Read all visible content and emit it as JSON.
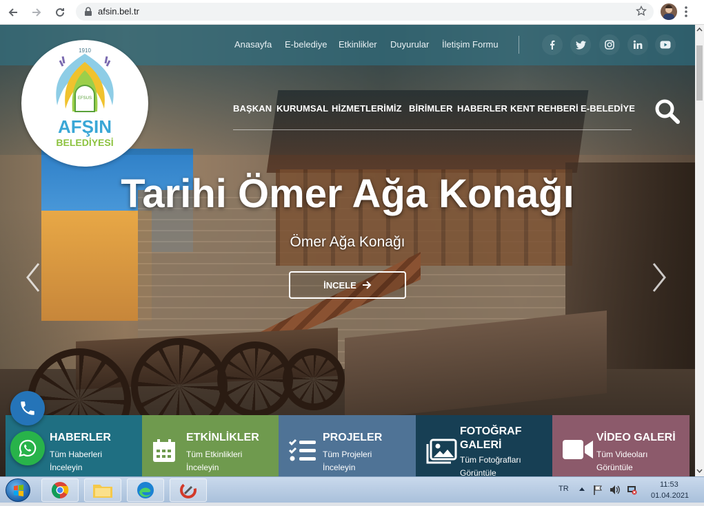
{
  "browser": {
    "url": "afsin.bel.tr",
    "profile_alt": "profile"
  },
  "logo": {
    "year": "1910",
    "arch_label": "EFSUS",
    "name": "AFŞIN",
    "subtitle": "BELEDİYESİ"
  },
  "topnav": {
    "items": [
      "Anasayfa",
      "E-belediye",
      "Etkinlikler",
      "Duyurular",
      "İletişim Formu"
    ],
    "social": [
      "facebook-icon",
      "twitter-icon",
      "instagram-icon",
      "linkedin-icon",
      "youtube-icon"
    ]
  },
  "mainnav": {
    "items": [
      "BAŞKAN",
      "KURUMSAL",
      "HİZMETLERİMİZ",
      "BİRİMLER",
      "HABERLER",
      "KENT REHBERİ",
      "E-BELEDİYE"
    ]
  },
  "slider": {
    "title": "Tarihi Ömer Ağa Konağı",
    "subtitle": "Ömer Ağa Konağı",
    "button": "İNCELE"
  },
  "tiles": [
    {
      "title": "HABERLER",
      "sub1": "Tüm Haberleri",
      "sub2": "İnceleyin",
      "color": "#1f6f82",
      "icon": "newspaper-icon"
    },
    {
      "title": "ETKİNLİKLER",
      "sub1": "Tüm Etkinlikleri",
      "sub2": "İnceleyin",
      "color": "#6f9a4e",
      "icon": "calendar-icon"
    },
    {
      "title": "PROJELER",
      "sub1": "Tüm Projeleri",
      "sub2": "İnceleyin",
      "color": "#4f7396",
      "icon": "list-icon"
    },
    {
      "title": "FOTOĞRAF GALERİ",
      "sub1": "Tüm Fotoğrafları",
      "sub2": "Görüntüle",
      "color": "#173f54",
      "icon": "image-icon"
    },
    {
      "title": "VİDEO GALERİ",
      "sub1": "Tüm Videoları",
      "sub2": "Görüntüle",
      "color": "#8c5a6b",
      "icon": "video-icon"
    }
  ],
  "taskbar": {
    "lang": "TR",
    "time": "11:53",
    "date": "01.04.2021"
  }
}
